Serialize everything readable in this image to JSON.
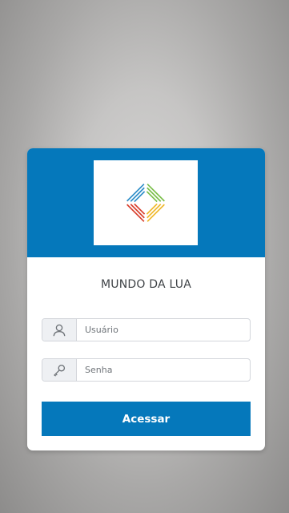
{
  "login": {
    "app_name": "MUNDO DA LUA",
    "username": {
      "icon": "user-icon",
      "placeholder": "Usuário",
      "value": ""
    },
    "password": {
      "icon": "key-icon",
      "placeholder": "Senha",
      "value": ""
    },
    "submit_label": "Acessar"
  },
  "colors": {
    "primary": "#0578bb",
    "logo_colors": [
      "#7bbf4b",
      "#2f8fc9",
      "#f0b92e",
      "#d9402e"
    ]
  }
}
